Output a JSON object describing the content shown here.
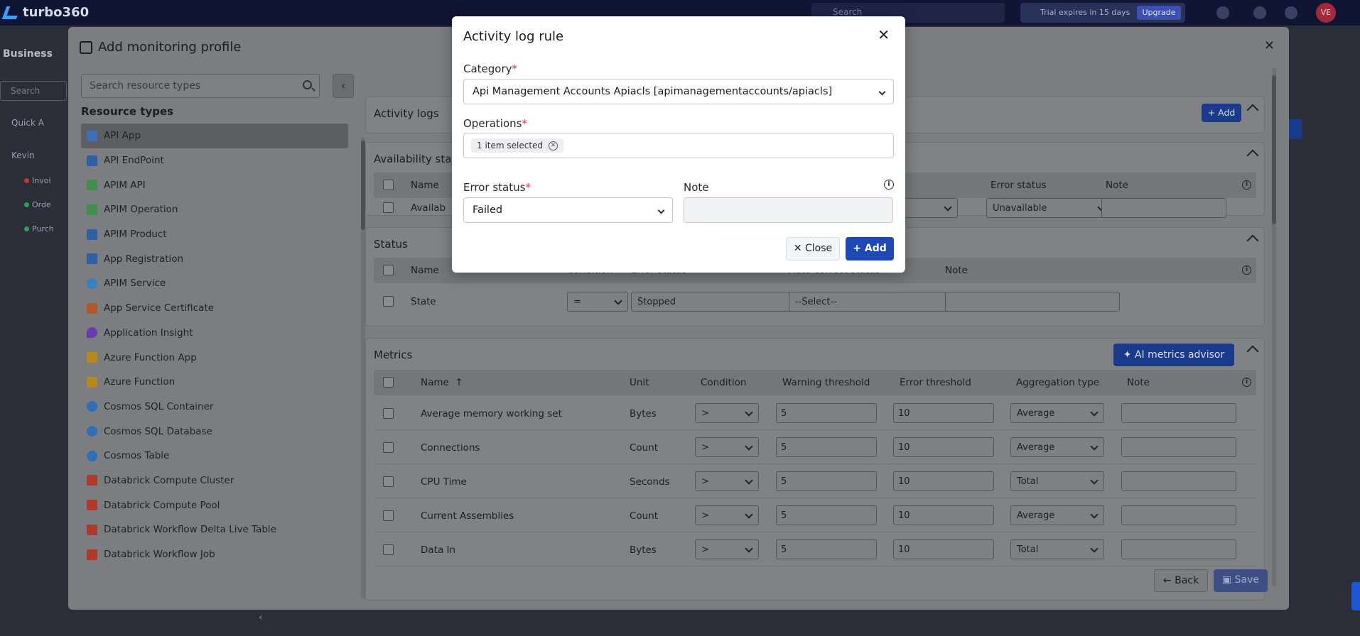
{
  "app": {
    "brand": "turbo360",
    "search_placeholder": "Search",
    "trial_text": "Trial expires in 15 days",
    "upgrade_label": "Upgrade",
    "avatar_initials": "VE",
    "notification_count": "3"
  },
  "background": {
    "business_app": "Business",
    "search_placeholder": "Search",
    "quick_access": "Quick A",
    "root_node": "Kevin",
    "tree": [
      {
        "label": "Invoi",
        "color": "#c0392b"
      },
      {
        "label": "Orde",
        "color": "#2e9e5b"
      },
      {
        "label": "Purch",
        "color": "#2e9e5b"
      }
    ]
  },
  "profile_modal": {
    "title": "Add monitoring profile",
    "search_placeholder": "Search resource types",
    "resource_types_heading": "Resource types",
    "resource_types": [
      {
        "label": "API App",
        "icon": "api-app-icon",
        "color": "#3f6fb5",
        "active": true
      },
      {
        "label": "API EndPoint",
        "icon": "api-endpoint-icon",
        "color": "#2f5fa5"
      },
      {
        "label": "APIM API",
        "icon": "apim-api-icon",
        "color": "#3f8f4f"
      },
      {
        "label": "APIM Operation",
        "icon": "apim-operation-icon",
        "color": "#3f8f4f"
      },
      {
        "label": "APIM Product",
        "icon": "apim-product-icon",
        "color": "#2f5fa5"
      },
      {
        "label": "App Registration",
        "icon": "app-registration-icon",
        "color": "#2f5fa5"
      },
      {
        "label": "APIM Service",
        "icon": "apim-service-icon",
        "color": "#3a7fbf"
      },
      {
        "label": "App Service Certificate",
        "icon": "certificate-icon",
        "color": "#b05a2a"
      },
      {
        "label": "Application Insight",
        "icon": "insight-icon",
        "color": "#6a3ab0"
      },
      {
        "label": "Azure Function App",
        "icon": "function-app-icon",
        "color": "#b58a1a"
      },
      {
        "label": "Azure Function",
        "icon": "function-icon",
        "color": "#b58a1a"
      },
      {
        "label": "Cosmos SQL Container",
        "icon": "cosmos-icon",
        "color": "#2f6fb5"
      },
      {
        "label": "Cosmos SQL Database",
        "icon": "cosmos-icon",
        "color": "#2f6fb5"
      },
      {
        "label": "Cosmos Table",
        "icon": "cosmos-icon",
        "color": "#2f6fb5"
      },
      {
        "label": "Databrick Compute Cluster",
        "icon": "databrick-icon",
        "color": "#b03a2a"
      },
      {
        "label": "Databrick Compute Pool",
        "icon": "databrick-icon",
        "color": "#b03a2a"
      },
      {
        "label": "Databrick Workflow Delta Live Table",
        "icon": "databrick-icon",
        "color": "#b03a2a"
      },
      {
        "label": "Databrick Workflow Job",
        "icon": "databrick-icon",
        "color": "#b03a2a"
      }
    ],
    "activity_logs": {
      "title": "Activity logs",
      "add_label": "+ Add"
    },
    "availability": {
      "title": "Availability stat",
      "headers": [
        "Name",
        "Error status",
        "Note"
      ],
      "row": {
        "name": "Availab",
        "error_status": "Unavailable"
      }
    },
    "status": {
      "title": "Status",
      "headers": [
        "Name",
        "Condition",
        "Error status",
        "Auto correct status",
        "Note"
      ],
      "row": {
        "name": "State",
        "condition": "=",
        "error_status": "Stopped",
        "auto_correct": "--Select--"
      }
    },
    "metrics": {
      "title": "Metrics",
      "ai_label": "AI metrics advisor",
      "headers": [
        "Name",
        "Unit",
        "Condition",
        "Warning threshold",
        "Error threshold",
        "Aggregation type",
        "Note"
      ],
      "rows": [
        {
          "name": "Average memory working set",
          "unit": "Bytes",
          "condition": ">",
          "warning": "5",
          "error": "10",
          "aggregation": "Average"
        },
        {
          "name": "Connections",
          "unit": "Count",
          "condition": ">",
          "warning": "5",
          "error": "10",
          "aggregation": "Average"
        },
        {
          "name": "CPU Time",
          "unit": "Seconds",
          "condition": ">",
          "warning": "5",
          "error": "10",
          "aggregation": "Total"
        },
        {
          "name": "Current Assemblies",
          "unit": "Count",
          "condition": ">",
          "warning": "5",
          "error": "10",
          "aggregation": "Average"
        },
        {
          "name": "Data In",
          "unit": "Bytes",
          "condition": ">",
          "warning": "5",
          "error": "10",
          "aggregation": "Total"
        }
      ]
    },
    "back_label": "Back",
    "save_label": "Save"
  },
  "dialog": {
    "title": "Activity log rule",
    "category_label": "Category",
    "category_value": "Api Management Accounts Apiacls [apimanagementaccounts/apiacls]",
    "operations_label": "Operations",
    "operations_chip": "1 item selected",
    "error_status_label": "Error status",
    "error_status_value": "Failed",
    "note_label": "Note",
    "close_label": "Close",
    "add_label": "Add"
  }
}
